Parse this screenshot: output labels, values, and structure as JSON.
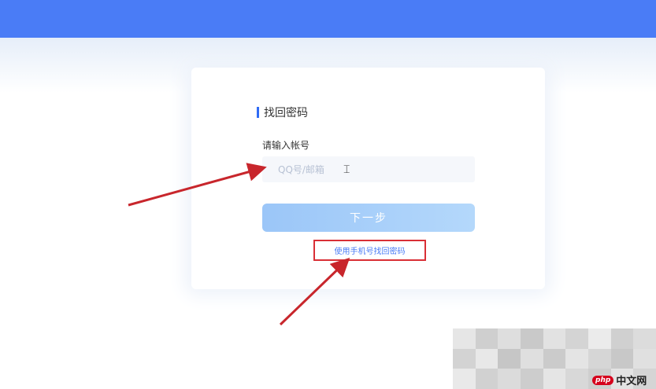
{
  "header": {
    "color": "#4a7cf6"
  },
  "form": {
    "title": "找回密码",
    "account_label": "请输入帐号",
    "account_placeholder": "QQ号/邮箱",
    "account_value": "",
    "next_label": "下一步",
    "phone_recovery_link": "使用手机号找回密码"
  },
  "annotations": {
    "arrow_color": "#c8262c",
    "highlight_color": "#d92f36"
  },
  "watermark": {
    "badge": "php",
    "site": "中文网"
  }
}
